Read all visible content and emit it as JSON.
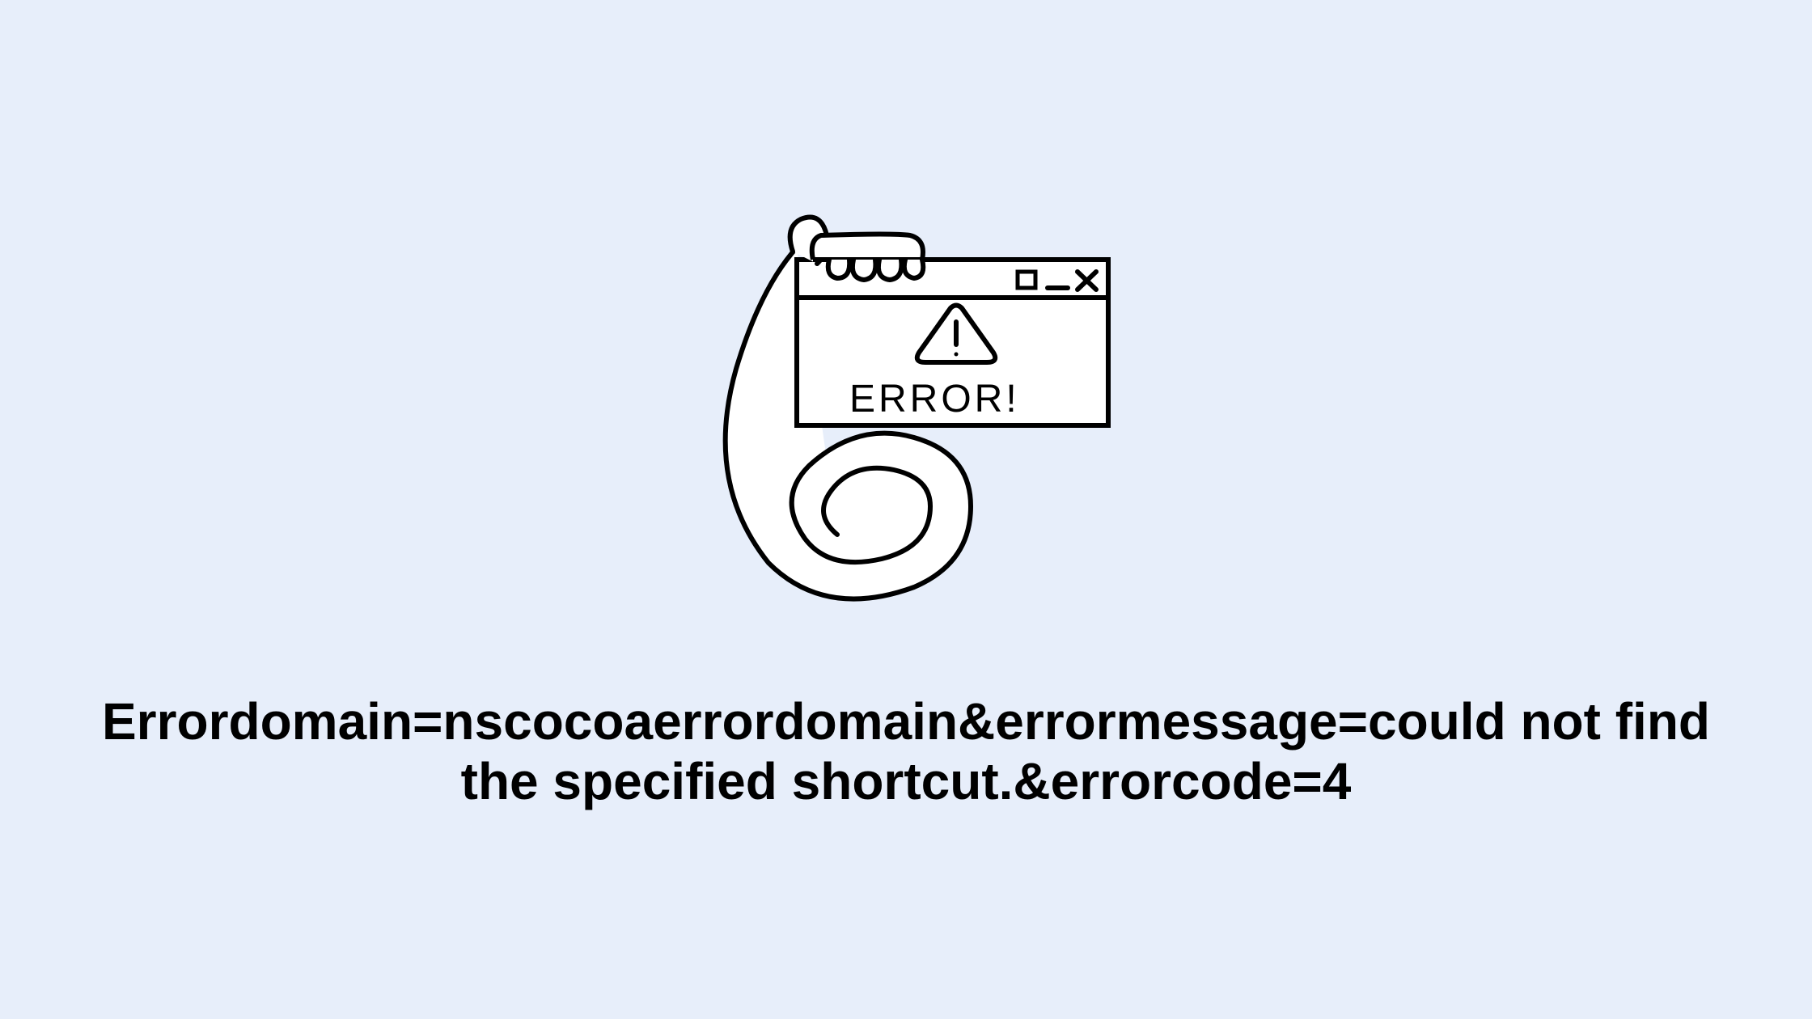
{
  "illustration": {
    "window_label": "ERROR!",
    "icon_name": "error-window-illustration"
  },
  "error_message": "Errordomain=nscocoaerrordomain&errormessage=could not find the specified shortcut.&errorcode=4"
}
